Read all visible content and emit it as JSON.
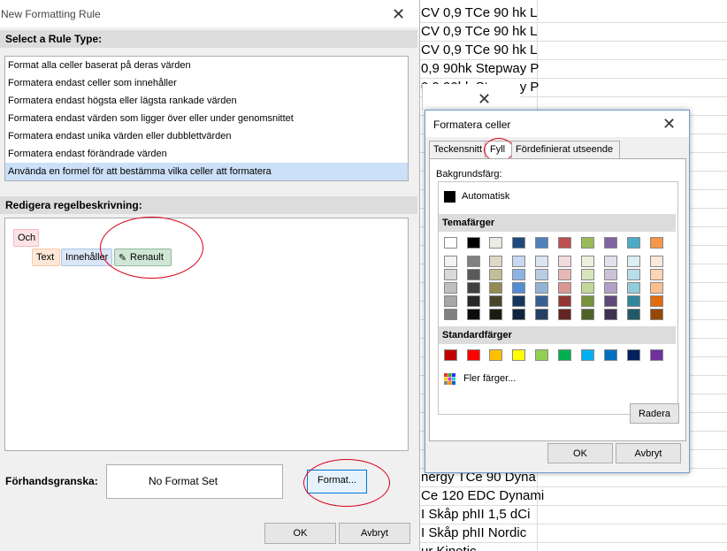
{
  "sheet": {
    "rows": [
      "CV 0,9 TCe 90 hk L",
      "CV 0,9 TCe 90 hk L",
      "CV 0,9 TCe 90 hk L",
      "0,9 90hk Stepway P",
      "0,9 90hk Stepway P",
      "",
      "",
      "",
      "",
      "",
      "",
      "",
      "",
      "",
      "",
      "",
      "",
      "",
      "",
      "",
      "",
      "",
      "",
      "",
      "",
      "nergy TCe 90 Dyna",
      "Ce 120 EDC Dynami",
      "I Skåp phII 1,5 dCi",
      "I Skåp  phII Nordic",
      "ur Kinetic"
    ]
  },
  "rule_dialog": {
    "title": "New Formatting Rule",
    "select_rule_type": "Select a Rule Type:",
    "rule_types": [
      "Format alla celler baserat på deras värden",
      "Formatera endast celler som innehåller",
      "Formatera endast högsta eller lägsta rankade värden",
      "Formatera endast värden som ligger över eller under genomsnittet",
      "Formatera endast unika värden eller dubblettvärden",
      "Formatera endast förändrade värden",
      "Använda en formel för att bestämma vilka celler att formatera"
    ],
    "selected_index": 6,
    "edit_rule": "Redigera regelbeskrivning:",
    "chips": {
      "och": "Och",
      "text": "Text",
      "contains": "Innehåller",
      "value": "Renault"
    },
    "preview_label": "Förhandsgranska:",
    "preview_text": "No Format Set",
    "format_button": "Format...",
    "ok": "OK",
    "cancel": "Avbryt"
  },
  "format_dialog": {
    "title": "Formatera celler",
    "tabs": [
      "Teckensnitt",
      "Fyll",
      "Fördefinierat utseende"
    ],
    "active_tab": "Fyll",
    "background_label": "Bakgrundsfärg:",
    "automatic": "Automatisk",
    "theme_colors_label": "Temafärger",
    "standard_colors_label": "Standardfärger",
    "more_colors": "Fler färger...",
    "clear": "Radera",
    "ok": "OK",
    "cancel": "Avbryt",
    "theme_colors": [
      [
        "#ffffff",
        "#f2f2f2",
        "#d9d9d9",
        "#bfbfbf",
        "#a6a6a6",
        "#808080"
      ],
      [
        "#000000",
        "#808080",
        "#595959",
        "#404040",
        "#262626",
        "#0d0d0d"
      ],
      [
        "#eeece1",
        "#ddd9c4",
        "#c4bd97",
        "#948a54",
        "#4a452a",
        "#1d1b10"
      ],
      [
        "#1f497d",
        "#c6d9f0",
        "#8db3e2",
        "#548dd4",
        "#17365d",
        "#0f243e"
      ],
      [
        "#4f81bd",
        "#dbe5f1",
        "#b8cce4",
        "#95b3d7",
        "#366092",
        "#244062"
      ],
      [
        "#c0504d",
        "#f2dcdb",
        "#e6b8b7",
        "#da9694",
        "#963634",
        "#632523"
      ],
      [
        "#9bbb59",
        "#ebf1de",
        "#d8e4bc",
        "#c4d79b",
        "#76933c",
        "#4f6228"
      ],
      [
        "#8064a2",
        "#e4dfec",
        "#ccc0da",
        "#b1a0c7",
        "#60497a",
        "#403151"
      ],
      [
        "#4bacc6",
        "#daeef3",
        "#b7dee8",
        "#92cddc",
        "#31869b",
        "#215967"
      ],
      [
        "#f79646",
        "#fde9d9",
        "#fcd5b4",
        "#fabf8f",
        "#e26b0a",
        "#974706"
      ]
    ],
    "standard_colors": [
      "#c00000",
      "#ff0000",
      "#ffc000",
      "#ffff00",
      "#92d050",
      "#00b050",
      "#00b0f0",
      "#0070c0",
      "#002060",
      "#7030a0"
    ]
  }
}
